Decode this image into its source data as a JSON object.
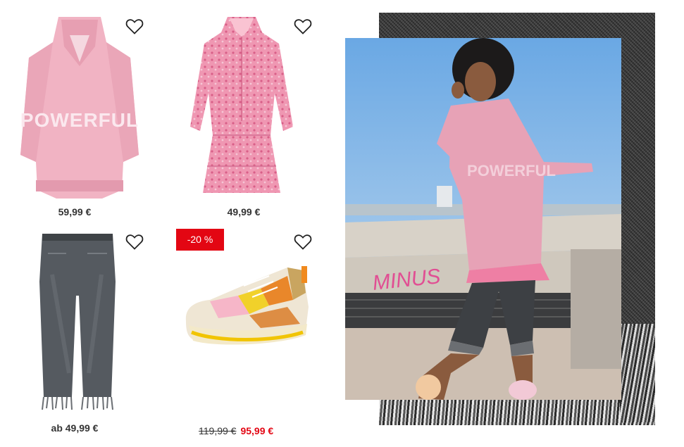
{
  "products": [
    {
      "name": "Strickpullover POWERFUL",
      "price": "59,99 €"
    },
    {
      "name": "Kleid mit Leoprint",
      "price": "49,99 €"
    },
    {
      "name": "Jeans mit Fransen",
      "price": "ab 49,99 €"
    },
    {
      "name": "Sneaker",
      "badge": "-20 %",
      "price_old": "119,99 €",
      "price_new": "95,99 €"
    }
  ],
  "colors": {
    "sale_red": "#e30613",
    "text": "#333333",
    "sweater_pink": "#f1b3c3",
    "dress_pink": "#ec8aa8"
  },
  "icons": {
    "wishlist": "heart-outline-icon"
  }
}
